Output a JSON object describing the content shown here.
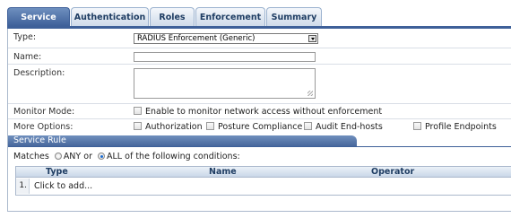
{
  "tabs": [
    {
      "label": "Service",
      "active": true
    },
    {
      "label": "Authentication",
      "active": false
    },
    {
      "label": "Roles",
      "active": false
    },
    {
      "label": "Enforcement",
      "active": false
    },
    {
      "label": "Summary",
      "active": false
    }
  ],
  "form": {
    "type_label": "Type:",
    "type_value": "RADIUS Enforcement (Generic)",
    "name_label": "Name:",
    "name_value": "",
    "description_label": "Description:",
    "description_value": "",
    "monitor_label": "Monitor Mode:",
    "monitor_option": "Enable to monitor network access without enforcement",
    "more_label": "More Options:",
    "more_options": [
      "Authorization",
      "Posture Compliance",
      "Audit End-hosts",
      "Profile Endpoints"
    ]
  },
  "service_rule": {
    "title": "Service Rule",
    "matches_prefix": "Matches",
    "any_label": "ANY",
    "or_label": "or",
    "all_label": "ALL",
    "matches_suffix": "of the following conditions:",
    "selected": "ALL",
    "columns": [
      "Type",
      "Name",
      "Operator"
    ],
    "rows": [
      {
        "num": "1.",
        "text": "Click to add..."
      }
    ]
  },
  "colors": {
    "accent": "#3e6099",
    "tab_text": "#1f3d63"
  }
}
